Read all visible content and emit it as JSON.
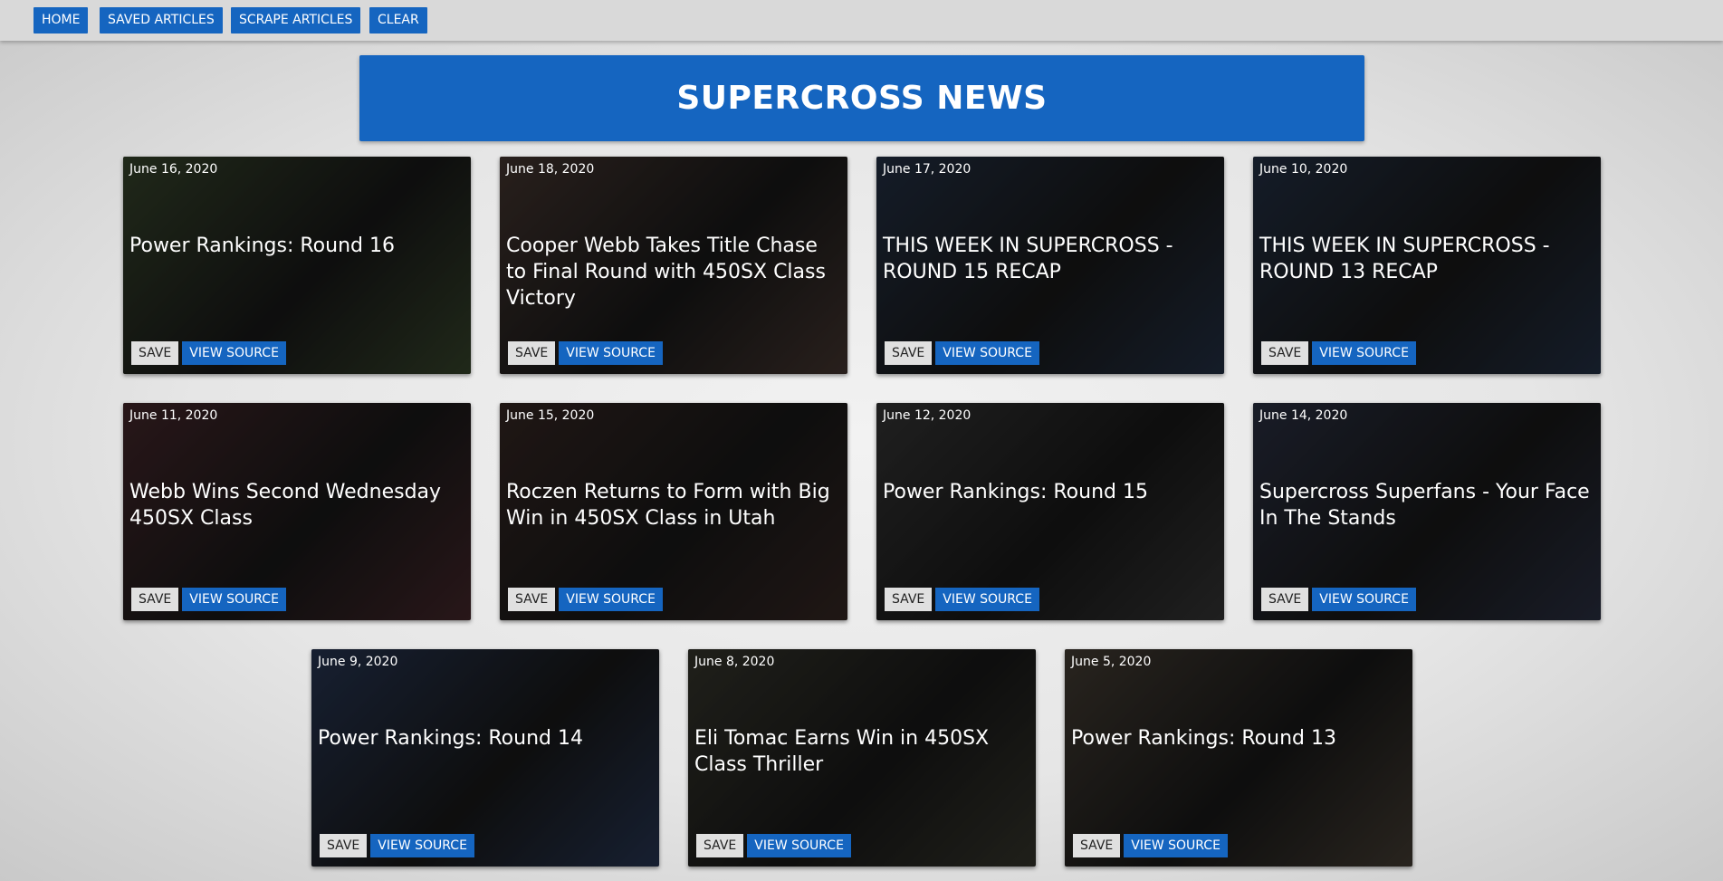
{
  "nav": {
    "home": "HOME",
    "saved": "SAVED ARTICLES",
    "scrape": "SCRAPE ARTICLES",
    "clear": "CLEAR"
  },
  "header": {
    "title": "SUPERCROSS NEWS"
  },
  "colors": {
    "accent": "#1565c0",
    "topbar": "#d9d9d9"
  },
  "articles": [
    {
      "date": "June 16, 2020",
      "title": "Power Rankings: Round 16",
      "save_label": "SAVE",
      "source_label": "VIEW SOURCE",
      "tone": "#3b4a2f"
    },
    {
      "date": "June 18, 2020",
      "title": "Cooper Webb Takes Title Chase to Final Round with 450SX Class Victory",
      "save_label": "SAVE",
      "source_label": "VIEW SOURCE",
      "tone": "#4a3a34"
    },
    {
      "date": "June 17, 2020",
      "title": "THIS WEEK IN SUPERCROSS - ROUND 15 RECAP",
      "save_label": "SAVE",
      "source_label": "VIEW SOURCE",
      "tone": "#26344a"
    },
    {
      "date": "June 10, 2020",
      "title": "THIS WEEK IN SUPERCROSS - ROUND 13 RECAP",
      "save_label": "SAVE",
      "source_label": "VIEW SOURCE",
      "tone": "#26344a"
    },
    {
      "date": "June 11, 2020",
      "title": "Webb Wins Second Wednesday 450SX Class",
      "save_label": "SAVE",
      "source_label": "VIEW SOURCE",
      "tone": "#4a2a2e"
    },
    {
      "date": "June 15, 2020",
      "title": "Roczen Returns to Form with Big Win in 450SX Class in Utah",
      "save_label": "SAVE",
      "source_label": "VIEW SOURCE",
      "tone": "#3a2a26"
    },
    {
      "date": "June 12, 2020",
      "title": "Power Rankings: Round 15",
      "save_label": "SAVE",
      "source_label": "VIEW SOURCE",
      "tone": "#3a3a3a"
    },
    {
      "date": "June 14, 2020",
      "title": "Supercross Superfans - Your Face In The Stands",
      "save_label": "SAVE",
      "source_label": "VIEW SOURCE",
      "tone": "#2e3448"
    },
    {
      "date": "June 9, 2020",
      "title": "Power Rankings: Round 14",
      "save_label": "SAVE",
      "source_label": "VIEW SOURCE",
      "tone": "#2a3a5a"
    },
    {
      "date": "June 8, 2020",
      "title": "Eli Tomac Earns Win in 450SX Class Thriller",
      "save_label": "SAVE",
      "source_label": "VIEW SOURCE",
      "tone": "#3a3a30"
    },
    {
      "date": "June 5, 2020",
      "title": "Power Rankings: Round 13",
      "save_label": "SAVE",
      "source_label": "VIEW SOURCE",
      "tone": "#4a4238"
    }
  ]
}
